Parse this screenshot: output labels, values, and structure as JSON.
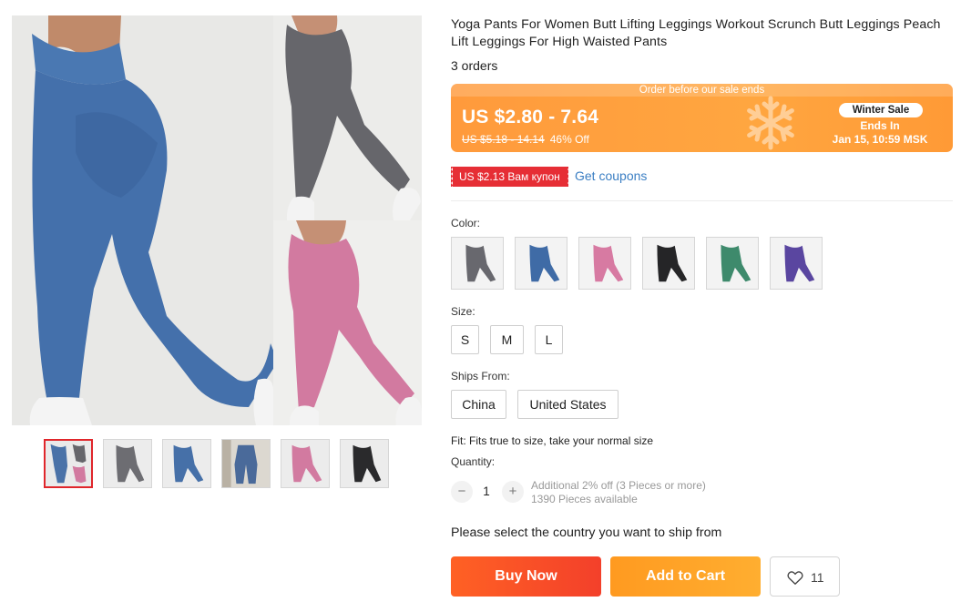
{
  "product": {
    "title": "Yoga Pants For Women Butt Lifting Leggings Workout Scrunch Butt Leggings Peach Lift Leggings For High Waisted Pants",
    "orders": "3 orders"
  },
  "gallery": {
    "main_image_colors": [
      "blue",
      "grey",
      "pink"
    ],
    "thumbnails": [
      {
        "name": "multi",
        "color": "#4a72a8",
        "active": true
      },
      {
        "name": "grey",
        "color": "#6d6d72",
        "active": false
      },
      {
        "name": "blue",
        "color": "#4670a8",
        "active": false
      },
      {
        "name": "blue-front",
        "color": "#4a6a9a",
        "active": false
      },
      {
        "name": "pink",
        "color": "#d27aa0",
        "active": false
      },
      {
        "name": "black",
        "color": "#2a2a2c",
        "active": false
      }
    ]
  },
  "sale": {
    "banner_text": "Order before our sale ends",
    "price_range": "US $2.80 - 7.64",
    "old_price": "US $5.18 - 14.14",
    "discount": "46% Off",
    "event_badge": "Winter Sale",
    "ends_in_label": "Ends In",
    "ends_date": "Jan 15, 10:59 MSK",
    "banner_color": "#ffa23e"
  },
  "coupon": {
    "tag": "US $2.13 Вам купон",
    "link": "Get coupons",
    "tag_color": "#e62e35",
    "link_color": "#3a7ec3"
  },
  "color": {
    "label": "Color:",
    "options": [
      {
        "name": "grey",
        "hex": "#68686e"
      },
      {
        "name": "blue",
        "hex": "#3f6ba6"
      },
      {
        "name": "pink",
        "hex": "#d77aa2"
      },
      {
        "name": "black",
        "hex": "#252527"
      },
      {
        "name": "green",
        "hex": "#3e8a6c"
      },
      {
        "name": "purple",
        "hex": "#5a46a0"
      }
    ]
  },
  "size": {
    "label": "Size:",
    "options": [
      "S",
      "M",
      "L"
    ]
  },
  "ships_from": {
    "label": "Ships From:",
    "options": [
      "China",
      "United States"
    ]
  },
  "fit": "Fit: Fits true to size, take your normal size",
  "quantity": {
    "label": "Quantity:",
    "value": "1",
    "minus": "−",
    "plus": "+",
    "note_discount": "Additional 2% off (3 Pieces or more)",
    "note_available": "1390 Pieces available"
  },
  "ship_message": "Please select the country you want to ship from",
  "actions": {
    "buy_now": "Buy Now",
    "add_to_cart": "Add to Cart",
    "wishlist_count": "11",
    "buy_color": "#f64a28",
    "cart_color": "#ffa125"
  }
}
